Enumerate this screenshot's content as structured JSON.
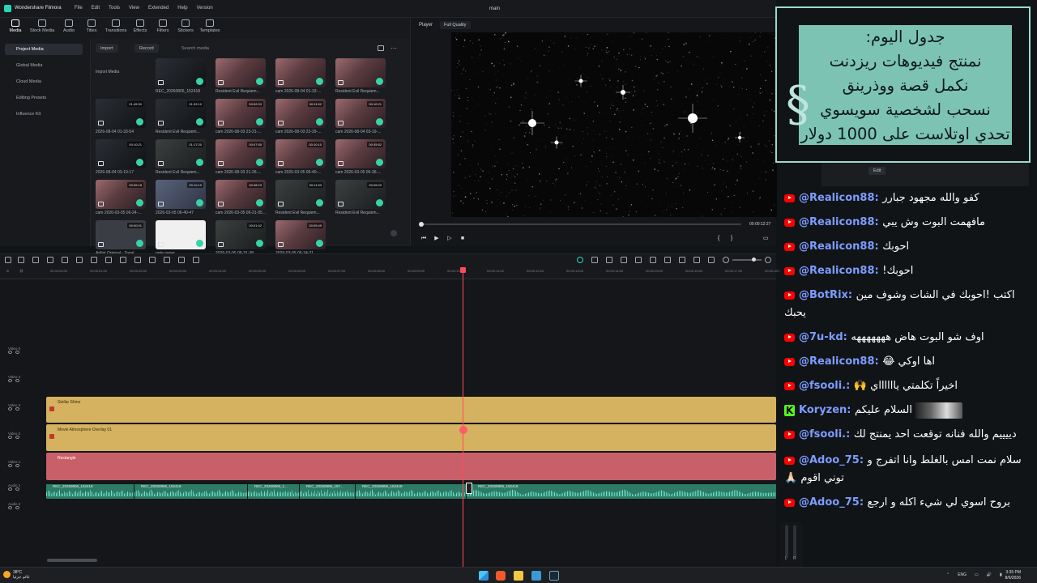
{
  "app": {
    "name": "Wondershare Filmora",
    "window_title": "main",
    "menu": [
      "File",
      "Edit",
      "Tools",
      "View",
      "Extended",
      "Help",
      "Version"
    ]
  },
  "toolbar": {
    "tools": [
      "Media",
      "Stock Media",
      "Audio",
      "Titles",
      "Transitions",
      "Effects",
      "Filters",
      "Stickers",
      "Templates"
    ],
    "active": "Media"
  },
  "sidebar": {
    "items": [
      "Project Media",
      "Global Media",
      "Cloud Media",
      "Editing Presets",
      "Influence Kit"
    ]
  },
  "media": {
    "import_label": "Import",
    "record_label": "Record",
    "search_placeholder": "Search media",
    "items": [
      {
        "caption": "Import Media",
        "duration": "",
        "style": "import"
      },
      {
        "caption": "REC_20260806_152418",
        "duration": "",
        "style": "dark"
      },
      {
        "caption": "Resident Evil Requiem...",
        "duration": "",
        "style": "room"
      },
      {
        "caption": "cam 2026-08-04 01-33-...",
        "duration": "",
        "style": "room"
      },
      {
        "caption": "Resident Evil Requiem...",
        "duration": "",
        "style": "room"
      },
      {
        "caption": "2026-08-04 01-33-54",
        "duration": "01:45:30",
        "style": "dark"
      },
      {
        "caption": "Resident Evil Requiem...",
        "duration": "01:32:10",
        "style": "dark"
      },
      {
        "caption": "cam 2026-08-03 23-21-...",
        "duration": "00:52:03",
        "style": "room"
      },
      {
        "caption": "cam 2026-08-03 22-29-...",
        "duration": "00:11:52",
        "style": "room"
      },
      {
        "caption": "cam 2026-08-04 03-19-...",
        "duration": "00:10:21",
        "style": "room"
      },
      {
        "caption": "2026-08-04 03-19-17",
        "duration": "00:10:21",
        "style": "dark"
      },
      {
        "caption": "Resident Evil Requiem...",
        "duration": "01:17:20",
        "style": "game"
      },
      {
        "caption": "cam 2026-08-03 21-26-...",
        "duration": "00:07:55",
        "style": "room"
      },
      {
        "caption": "cam 2026-03-05 06-40-...",
        "duration": "00:10:10",
        "style": "room"
      },
      {
        "caption": "cam 2026-03-05 06-36-...",
        "duration": "00:35:52",
        "style": "room"
      },
      {
        "caption": "cam 2026-03-05 06-24-...",
        "duration": "00:05:18",
        "style": "room"
      },
      {
        "caption": "2026-03-05 06-40-47",
        "duration": "00:10:10",
        "style": "blue"
      },
      {
        "caption": "cam 2026-03-05 06-21-05...",
        "duration": "00:38:23",
        "style": "room"
      },
      {
        "caption": "Resident Evil Requiem...",
        "duration": "00:11:53",
        "style": "game"
      },
      {
        "caption": "Resident Evil Requiem...",
        "duration": "00:05:03",
        "style": "game"
      },
      {
        "caption": "Artlist Original - Tonal...",
        "duration": "00:00:01",
        "style": "gray"
      },
      {
        "caption": "note paper",
        "duration": "",
        "style": "white"
      },
      {
        "caption": "2026-03-05 06-31-38",
        "duration": "00:01:42",
        "style": "game"
      },
      {
        "caption": "2026-03-05 06-24-31",
        "duration": "00:05:49",
        "style": "room"
      }
    ]
  },
  "player": {
    "label": "Player",
    "quality": "Full Quality",
    "timecode": "00:00:12:27",
    "progress": 0.0
  },
  "timeline": {
    "ruler": [
      "00:00:00:00",
      "00:00:01:00",
      "00:00:02:00",
      "00:00:03:00",
      "00:00:04:00",
      "00:00:05:00",
      "00:00:06:00",
      "00:00:07:00",
      "00:00:08:00",
      "00:00:09:00",
      "00:00:10:00",
      "00:00:11:00",
      "00:00:12:00",
      "00:00:13:00",
      "00:00:14:00",
      "00:00:15:00",
      "00:00:16:00",
      "00:00:17:00",
      "00:00:18:00",
      "00:00:19:00"
    ],
    "tracks": [
      "Video 5",
      "Video 4",
      "Video 3",
      "Video 2",
      "Video 1",
      "Audio 1",
      "Audio 2"
    ],
    "clips": {
      "v3": "Stellar Shine",
      "v2": "Movie Atmosphere Overlay 01",
      "v1": "Rectangle",
      "audio": [
        "REC_20260806_152418",
        "REC_20260806_152418",
        "REC_20260806_1...",
        "REC_20260806_157...",
        "REC_20260806_152418",
        "REC_20260806_152418"
      ]
    }
  },
  "agenda": {
    "lines": [
      "جدول اليوم:",
      "نمنتج فيديوهات ريزدنت",
      "نكمل قصة ووذرينق",
      "نسحب لشخصية سويسوي",
      "تحدي اوتلاست على 1000 دولار"
    ]
  },
  "panel": {
    "edit_label": "Edit"
  },
  "chat": {
    "messages": [
      {
        "platform": "youtube",
        "user": "@Realicon88:",
        "text": "كفو والله مجهود جبارر"
      },
      {
        "platform": "youtube",
        "user": "@Realicon88:",
        "text": "مافهمت البوت وش يبي"
      },
      {
        "platform": "youtube",
        "user": "@Realicon88:",
        "text": "احوبك"
      },
      {
        "platform": "youtube",
        "user": "@Realicon88:",
        "text": "احوبك!"
      },
      {
        "platform": "youtube",
        "user": "@BotRix:",
        "text": "اكتب !احوبك في الشات وشوف مين يحبك"
      },
      {
        "platform": "youtube",
        "user": "@7u-kd:",
        "text": "اوف شو البوت هاض هههههههه"
      },
      {
        "platform": "youtube",
        "user": "@Realicon88:",
        "text": "اها اوكي 😂"
      },
      {
        "platform": "youtube",
        "user": "@fsooli.:",
        "text": "اخيراً تكلمتي يااااااي 🙌"
      },
      {
        "platform": "kick",
        "user": "Koryzen:",
        "text": "السلام عليكم"
      },
      {
        "platform": "youtube",
        "user": "@fsooli.:",
        "text": "دييييم والله فنانه توقعت احد يمنتج لك"
      },
      {
        "platform": "youtube",
        "user": "@Adoo_75:",
        "text": "سلام نمت امس بالغلط وانا اتفرج و توني اقوم 🙏🏻"
      },
      {
        "platform": "youtube",
        "user": "@Adoo_75:",
        "text": "بروح اسوي لي شيء اكله و ارجع"
      }
    ]
  },
  "meter": {
    "labels": [
      "L",
      "R"
    ]
  },
  "taskbar": {
    "weather_temp": "38°C",
    "weather_desc": "غائم جزئيا",
    "lang": "ENG",
    "time": "3:35 PM",
    "date": "8/6/2026"
  },
  "colors": {
    "accent": "#2bd5b4",
    "clip_yellow": "#d4b25f",
    "clip_red": "#c8606a",
    "audio": "#2d7a67",
    "playhead": "#ff4a5a",
    "agenda_bg": "#7cc3b3",
    "chat_user": "#7d9cff"
  }
}
